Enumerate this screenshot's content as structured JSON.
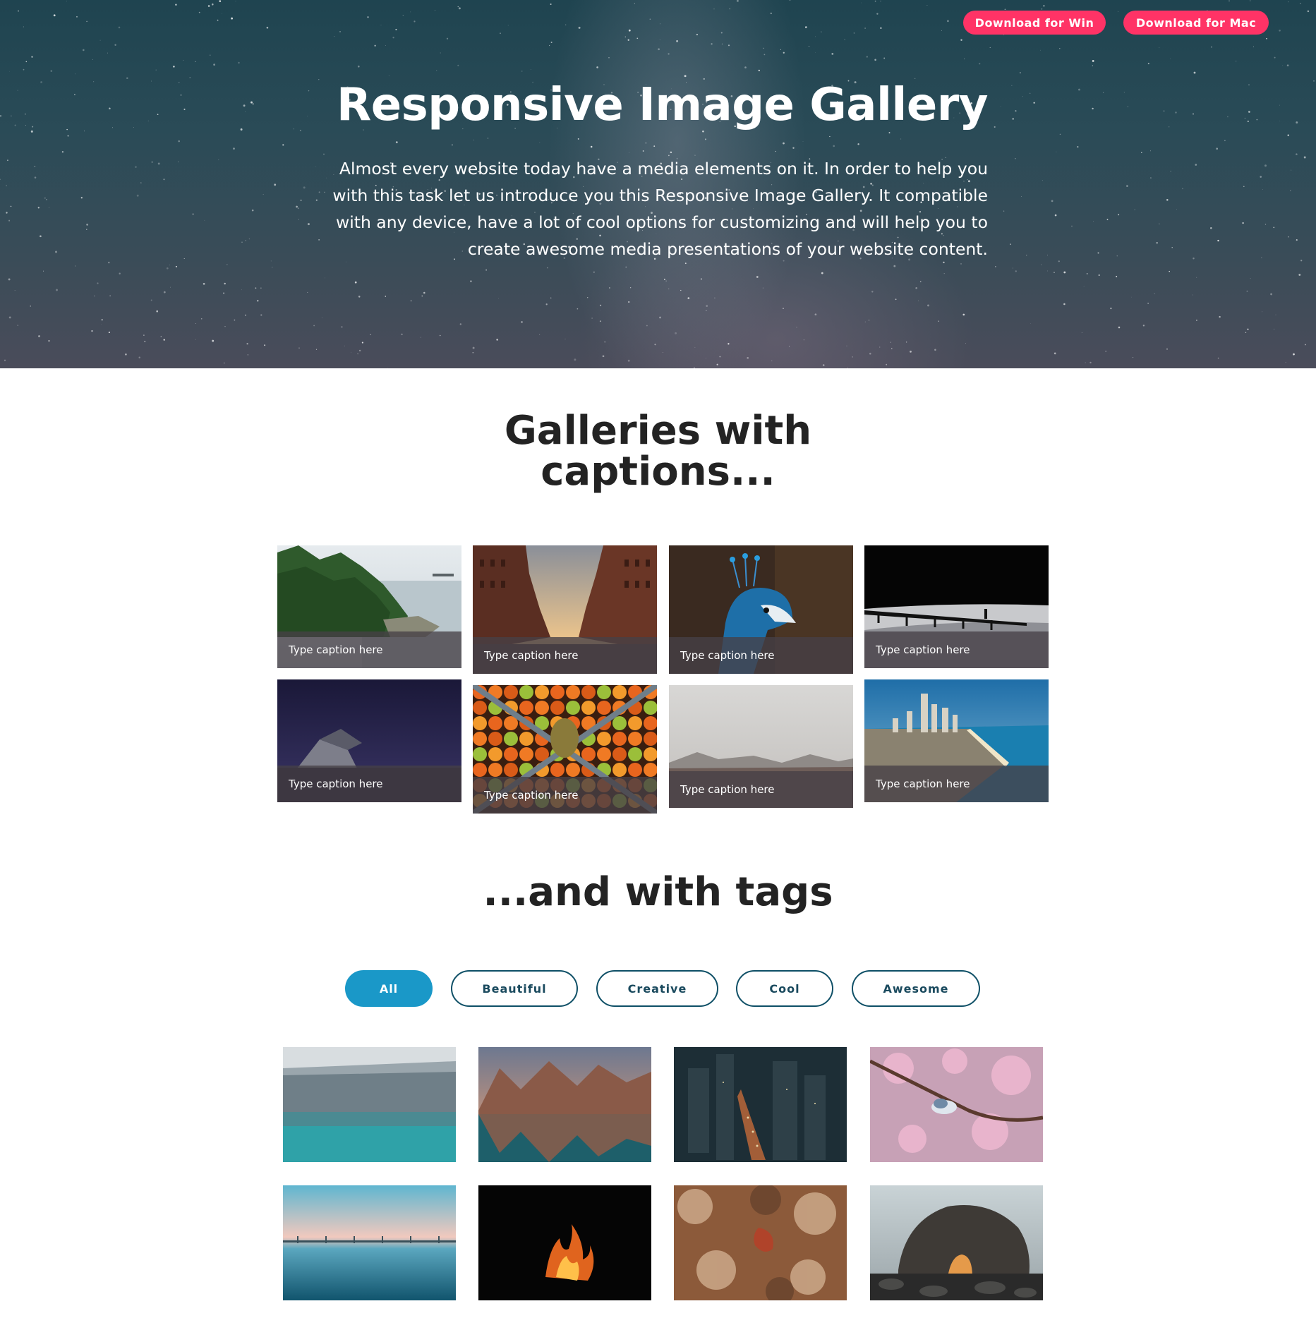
{
  "hero": {
    "download_win": "Download for Win",
    "download_mac": "Download for Mac",
    "title": "Responsive Image Gallery",
    "description": "Almost every website today have a media elements on it. In order to help you with this task let us introduce you this Responsive Image Gallery. It compatible with any device, have a lot of cool options for customizing and will help you to create awesome media presentations of your website content."
  },
  "captions_section": {
    "title_line1": "Galleries with",
    "title_line2": "captions...",
    "items": [
      {
        "caption": "Type caption here",
        "image": "forest-coast"
      },
      {
        "caption": "Type caption here",
        "image": "brick-buildings-canal"
      },
      {
        "caption": "Type caption here",
        "image": "peacock"
      },
      {
        "caption": "Type caption here",
        "image": "pier-silhouette"
      },
      {
        "caption": "Type caption here",
        "image": "abandoned-house-night"
      },
      {
        "caption": "Type caption here",
        "image": "fruit-crates"
      },
      {
        "caption": "Type caption here",
        "image": "misty-mountains"
      },
      {
        "caption": "Type caption here",
        "image": "coastal-city"
      }
    ]
  },
  "tags_section": {
    "title": "...and with tags",
    "filters": [
      "All",
      "Beautiful",
      "Creative",
      "Cool",
      "Awesome"
    ],
    "active_filter": "All",
    "items": [
      {
        "image": "frosty-lake"
      },
      {
        "image": "mountain-lake-sunset"
      },
      {
        "image": "city-night-aerial"
      },
      {
        "image": "bird-cherry-blossom"
      },
      {
        "image": "calm-sea-dusk"
      },
      {
        "image": "campfire-dark"
      },
      {
        "image": "autumn-leaf"
      },
      {
        "image": "rock-arch-beach"
      }
    ]
  },
  "colors": {
    "accent_pink": "#ff3366",
    "accent_blue": "#1a98c8",
    "tag_border": "#0e4f66"
  }
}
